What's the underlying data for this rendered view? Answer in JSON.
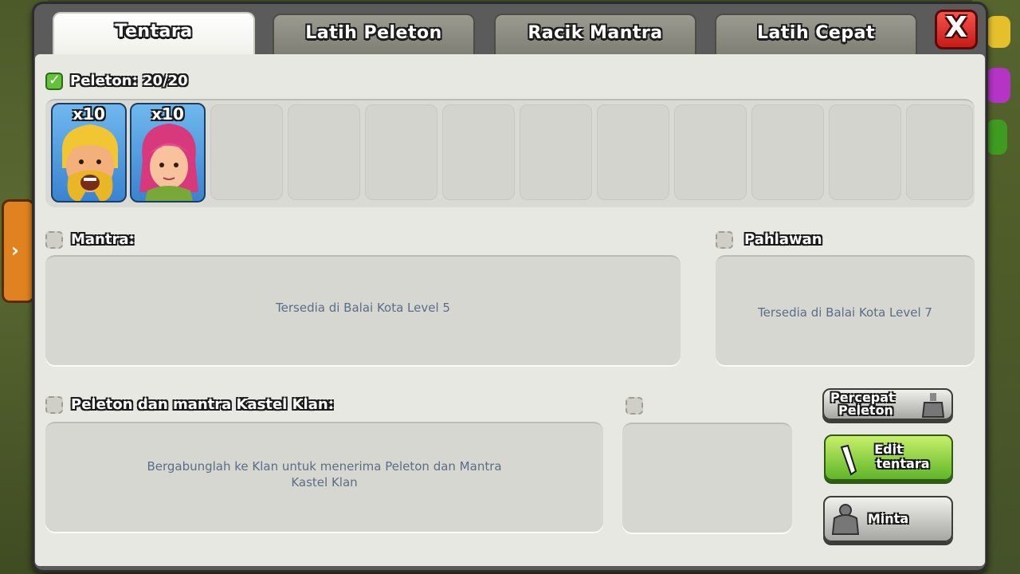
{
  "tabs": [
    {
      "label": "Tentara",
      "active": true
    },
    {
      "label": "Latih Peleton",
      "active": false
    },
    {
      "label": "Racik Mantra",
      "active": false
    },
    {
      "label": "Latih Cepat",
      "active": false
    }
  ],
  "close_label": "X",
  "troops": {
    "title": "Peleton: 20/20",
    "units": [
      {
        "name": "barbarian",
        "count": "x10"
      },
      {
        "name": "archer",
        "count": "x10"
      }
    ]
  },
  "spells": {
    "title": "Mantra:",
    "message": "Tersedia di Balai Kota Level 5"
  },
  "heroes": {
    "title": "Pahlawan",
    "message": "Tersedia di Balai Kota Level 7"
  },
  "clan_castle": {
    "title": "Peleton dan mantra Kastel Klan:",
    "message_line1": "Bergabunglah ke Klan untuk menerima Peleton dan Mantra",
    "message_line2": "Kastel Klan"
  },
  "buttons": {
    "boost_line1": "Percepat",
    "boost_line2": "Peleton",
    "edit_line1": "Edit",
    "edit_line2": "tentara",
    "request": "Minta"
  },
  "colors": {
    "panel": "#e8e8e2",
    "message_text": "#5a6e86",
    "green_button": "#5fb52a",
    "close_red": "#c81b16"
  }
}
